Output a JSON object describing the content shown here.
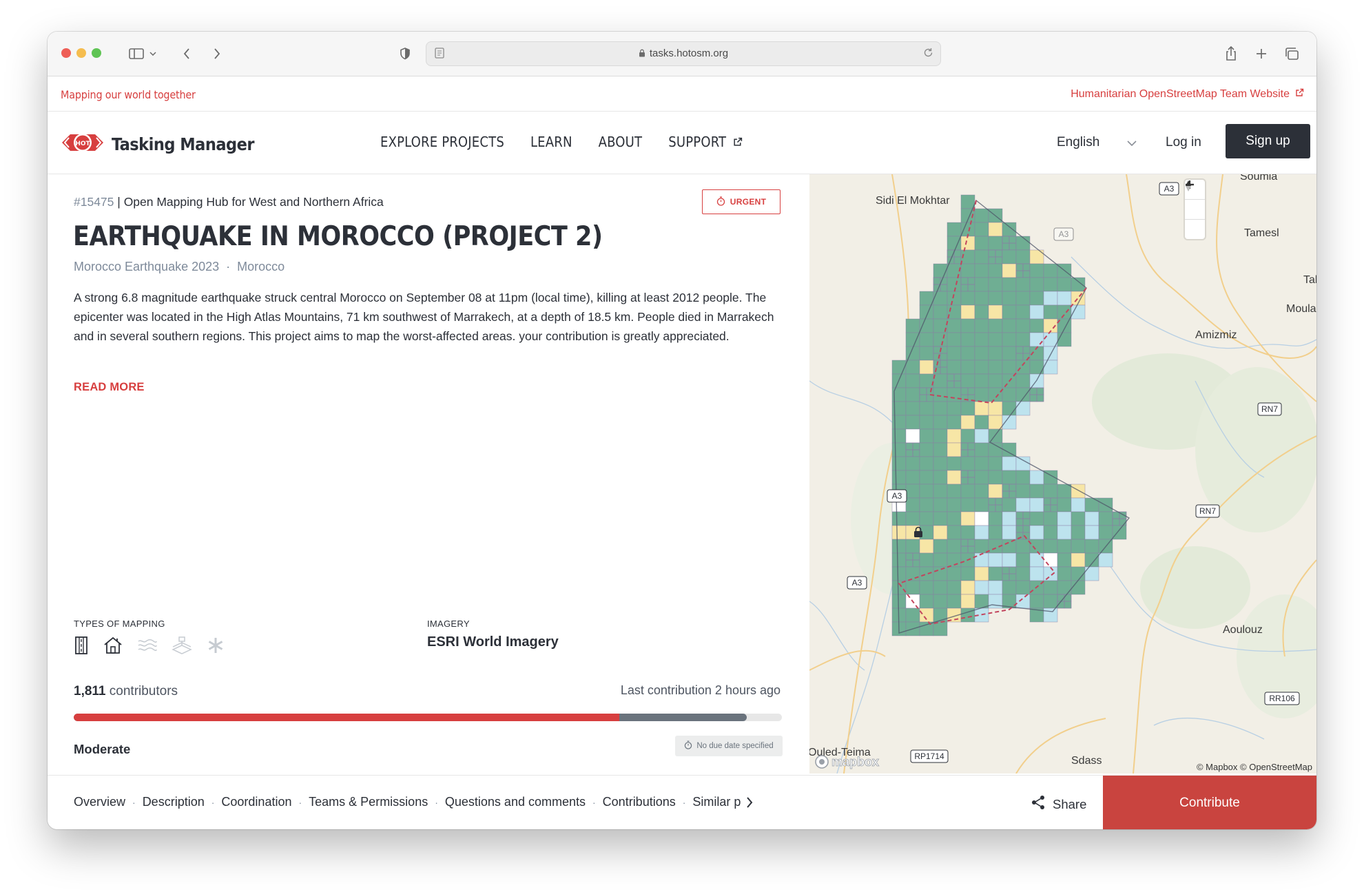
{
  "browser": {
    "url": "tasks.hotosm.org",
    "icons": [
      "sidebar-icon",
      "chevron-down-icon",
      "back-icon",
      "forward-icon",
      "shield-icon",
      "reader-icon",
      "lock-icon",
      "reload-icon",
      "share-icon",
      "new-tab-icon",
      "tabs-icon"
    ]
  },
  "topbar": {
    "tagline": "Mapping our world together",
    "hot_link": "Humanitarian OpenStreetMap Team Website"
  },
  "nav": {
    "logo_text": "Tasking Manager",
    "logo_badge": "HOT",
    "menu": [
      "EXPLORE PROJECTS",
      "LEARN",
      "ABOUT",
      "SUPPORT"
    ],
    "language": "English",
    "login": "Log in",
    "signup": "Sign up"
  },
  "project": {
    "id": "#15475",
    "separator": " | ",
    "organisation": "Open Mapping Hub for West and Northern Africa",
    "priority": "URGENT",
    "title": "EARTHQUAKE IN MOROCCO (PROJECT 2)",
    "campaign": "Morocco Earthquake 2023",
    "tag_sep": "·",
    "country": "Morocco",
    "description": "A strong 6.8 magnitude earthquake struck central Morocco on September 08 at 11pm (local time), killing at least 2012 people. The epicenter was located in the High Atlas Mountains, 71 km southwest of Marrakech, at a depth of 18.5 km. People died in Marrakech and in several southern regions. This project aims to map the worst-affected areas. your contribution is greatly appreciated.",
    "read_more": "READ MORE",
    "types_label": "TYPES OF MAPPING",
    "mapping_types": [
      {
        "name": "roads-icon",
        "active": true
      },
      {
        "name": "buildings-icon",
        "active": true
      },
      {
        "name": "waterways-icon",
        "active": false
      },
      {
        "name": "landuse-icon",
        "active": false
      },
      {
        "name": "other-icon",
        "active": false
      }
    ],
    "imagery_label": "IMAGERY",
    "imagery": "ESRI World Imagery",
    "contributors_count": "1,811",
    "contributors_label": "contributors",
    "last_contribution": "Last contribution 2 hours ago",
    "progress": {
      "mapped_percent": 77,
      "validated_percent": 95
    },
    "difficulty": "Moderate",
    "due_date": "No due date specified"
  },
  "map": {
    "labels": [
      {
        "text": "Sidi El Mokhtar"
      },
      {
        "text": "Soumia"
      },
      {
        "text": "Tamesl"
      },
      {
        "text": "Tal"
      },
      {
        "text": "Moula"
      },
      {
        "text": "Amizmiz"
      },
      {
        "text": "Aoulouz"
      },
      {
        "text": "Sdass"
      },
      {
        "text": "Ouled-Teima"
      }
    ],
    "road_shields": [
      "A3",
      "A3",
      "A3",
      "A3",
      "RN7",
      "RN7",
      "RR106",
      "RP1714"
    ],
    "attribution": "© Mapbox © OpenStreetMap",
    "mapbox": "mapbox",
    "colors": {
      "unmapped": "#6fae93",
      "mapped": "#bde3ee",
      "validated": "#ffffff",
      "locked": "#f7e6a6",
      "outline": "#8c7aa5"
    }
  },
  "bottom": {
    "tabs": [
      "Overview",
      "Description",
      "Coordination",
      "Teams & Permissions",
      "Questions and comments",
      "Contributions",
      "Similar p"
    ],
    "share": "Share",
    "contribute": "Contribute",
    "accent": "#c9443f"
  }
}
